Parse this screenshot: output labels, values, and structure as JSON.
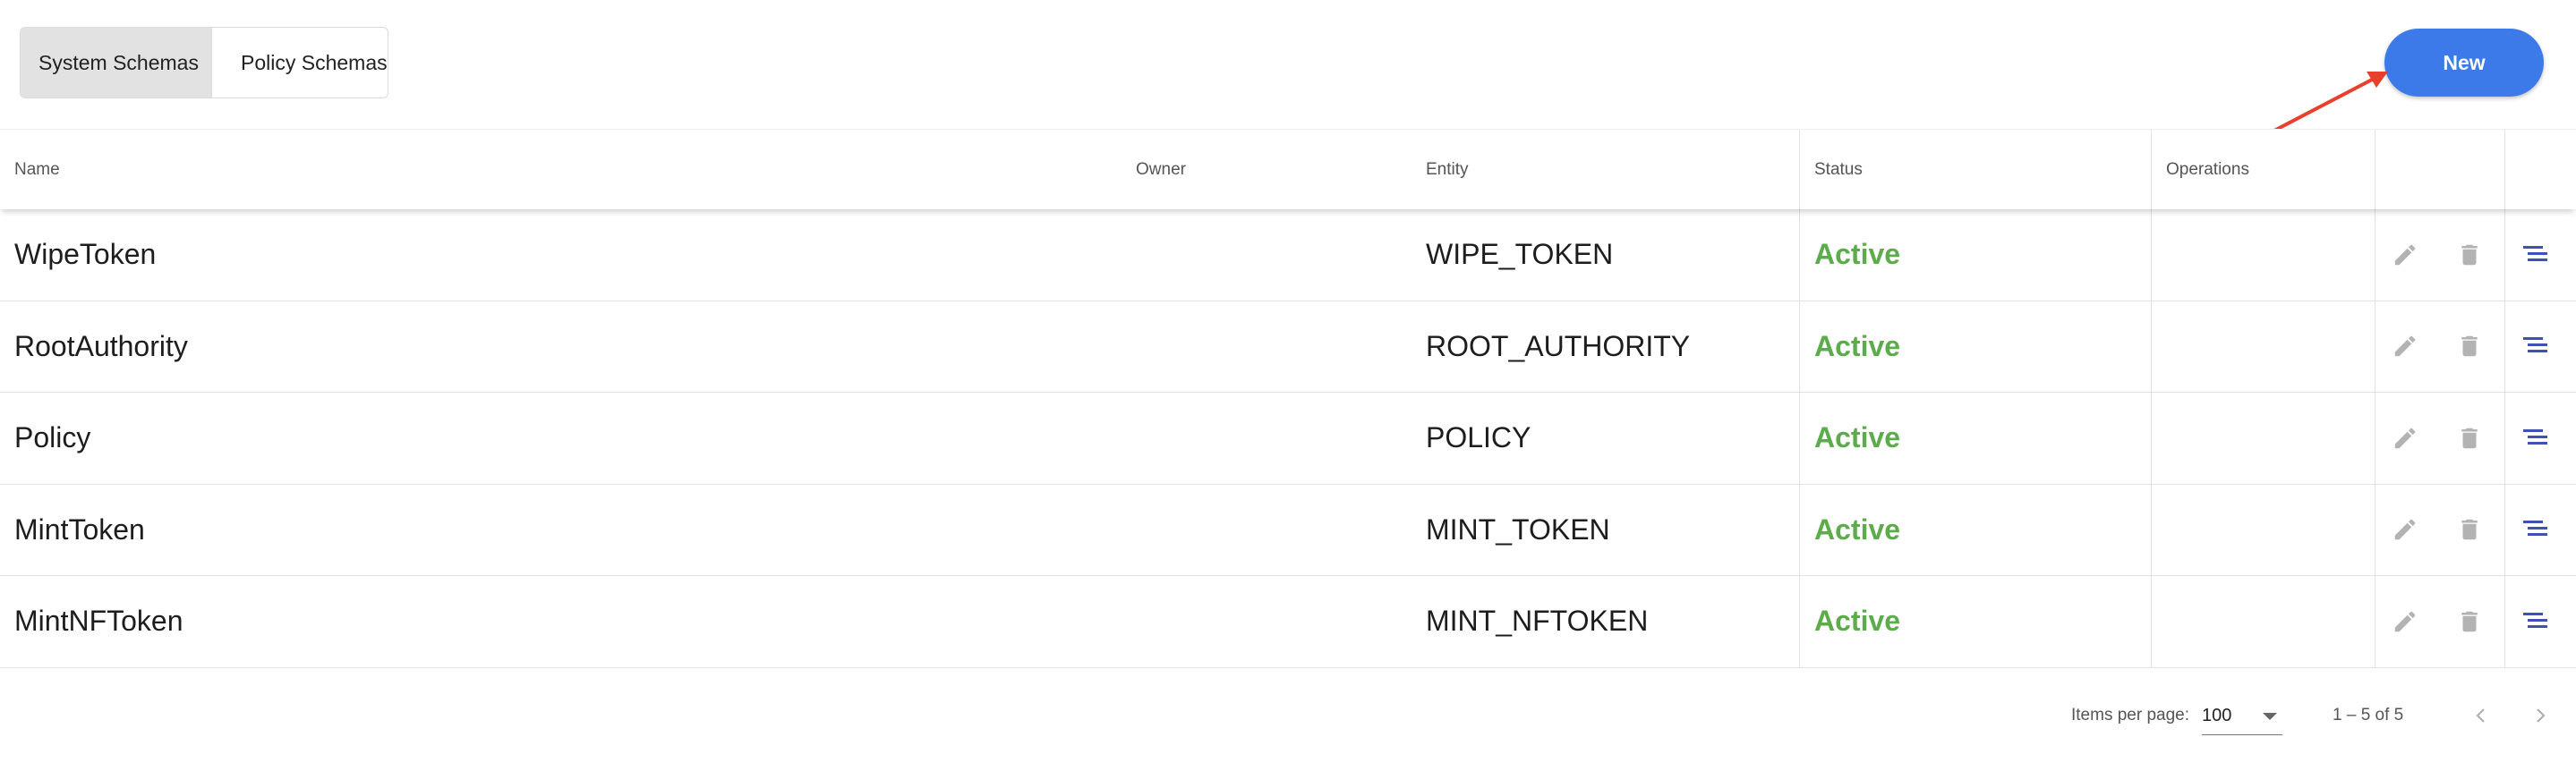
{
  "tabs": [
    {
      "label": "System Schemas",
      "active": true
    },
    {
      "label": "Policy Schemas",
      "active": false
    }
  ],
  "new_button": {
    "label": "New",
    "color": "#3b7ae8"
  },
  "annotation": {
    "type": "arrow",
    "color": "#e8402c",
    "target": "new-button"
  },
  "table": {
    "columns": {
      "name": "Name",
      "owner": "Owner",
      "entity": "Entity",
      "status": "Status",
      "operations": "Operations"
    },
    "rows": [
      {
        "name": "WipeToken",
        "owner": "",
        "entity": "WIPE_TOKEN",
        "status": "Active"
      },
      {
        "name": "RootAuthority",
        "owner": "",
        "entity": "ROOT_AUTHORITY",
        "status": "Active"
      },
      {
        "name": "Policy",
        "owner": "",
        "entity": "POLICY",
        "status": "Active"
      },
      {
        "name": "MintToken",
        "owner": "",
        "entity": "MINT_TOKEN",
        "status": "Active"
      },
      {
        "name": "MintNFToken",
        "owner": "",
        "entity": "MINT_NFTOKEN",
        "status": "Active"
      }
    ],
    "row_icons": [
      "edit-icon",
      "delete-icon",
      "document-icon"
    ],
    "status_color": "#5cac4c",
    "document_icon_color": "#3f51b5"
  },
  "paginator": {
    "items_per_page_label": "Items per page:",
    "items_per_page_value": "100",
    "range": "1 – 5 of 5"
  }
}
